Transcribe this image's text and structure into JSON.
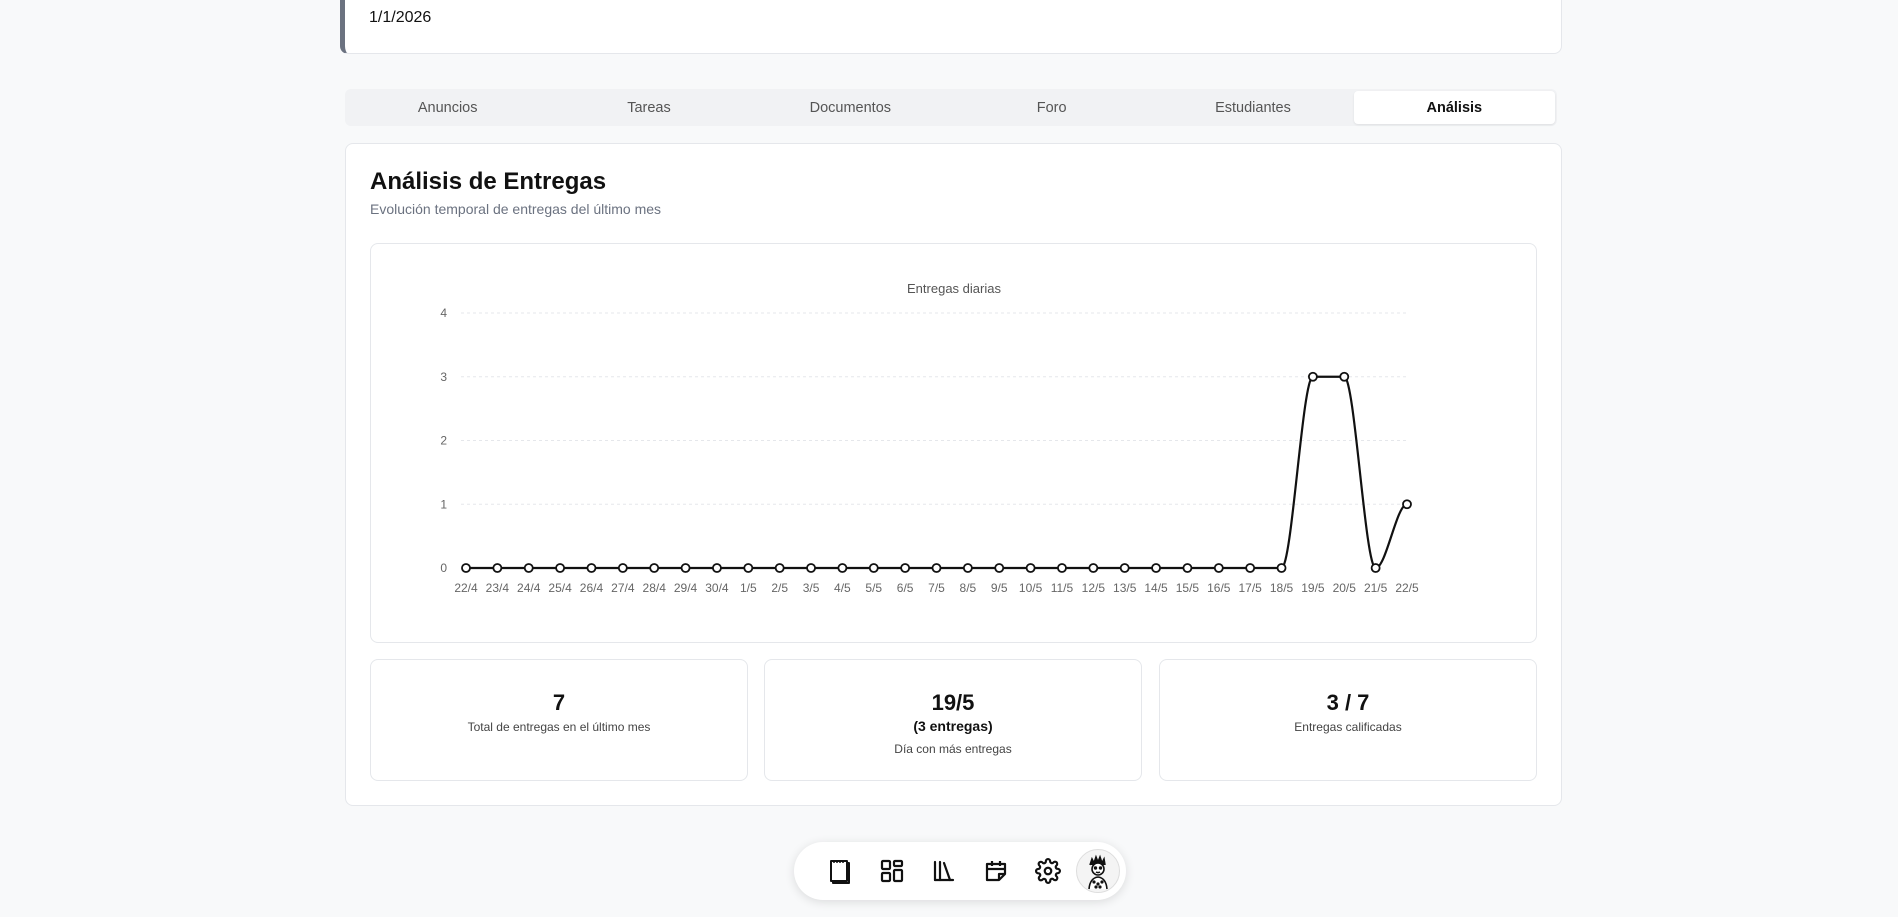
{
  "course_info": {
    "date": "1/1/2026"
  },
  "tabs": [
    {
      "label": "Anuncios",
      "active": false
    },
    {
      "label": "Tareas",
      "active": false
    },
    {
      "label": "Documentos",
      "active": false
    },
    {
      "label": "Foro",
      "active": false
    },
    {
      "label": "Estudiantes",
      "active": false
    },
    {
      "label": "Análisis",
      "active": true
    }
  ],
  "analysis": {
    "title": "Análisis de Entregas",
    "subtitle": "Evolución temporal de entregas del último mes"
  },
  "chart_data": {
    "type": "line",
    "title": "Entregas diarias",
    "xlabel": "",
    "ylabel": "",
    "ylim": [
      0,
      4
    ],
    "yticks": [
      0,
      1,
      2,
      3,
      4
    ],
    "grid": true,
    "x": [
      "22/4",
      "23/4",
      "24/4",
      "25/4",
      "26/4",
      "27/4",
      "28/4",
      "29/4",
      "30/4",
      "1/5",
      "2/5",
      "3/5",
      "4/5",
      "5/5",
      "6/5",
      "7/5",
      "8/5",
      "9/5",
      "10/5",
      "11/5",
      "12/5",
      "13/5",
      "14/5",
      "15/5",
      "16/5",
      "17/5",
      "18/5",
      "19/5",
      "20/5",
      "21/5",
      "22/5"
    ],
    "series": [
      {
        "values": [
          0,
          0,
          0,
          0,
          0,
          0,
          0,
          0,
          0,
          0,
          0,
          0,
          0,
          0,
          0,
          0,
          0,
          0,
          0,
          0,
          0,
          0,
          0,
          0,
          0,
          0,
          0,
          3,
          3,
          0,
          1
        ],
        "color": "#111111"
      }
    ]
  },
  "stats": {
    "total": {
      "value": "7",
      "label": "Total de entregas en el último mes"
    },
    "peak": {
      "value": "19/5",
      "detail": "(3 entregas)",
      "label": "Día con más entregas"
    },
    "graded": {
      "value": "3 / 7",
      "label": "Entregas calificadas"
    }
  },
  "dock": {
    "items": [
      {
        "icon": "notebook-icon"
      },
      {
        "icon": "dashboard-icon"
      },
      {
        "icon": "library-icon"
      },
      {
        "icon": "calendar-icon"
      },
      {
        "icon": "gear-icon"
      },
      {
        "icon": "avatar-icon"
      }
    ]
  }
}
